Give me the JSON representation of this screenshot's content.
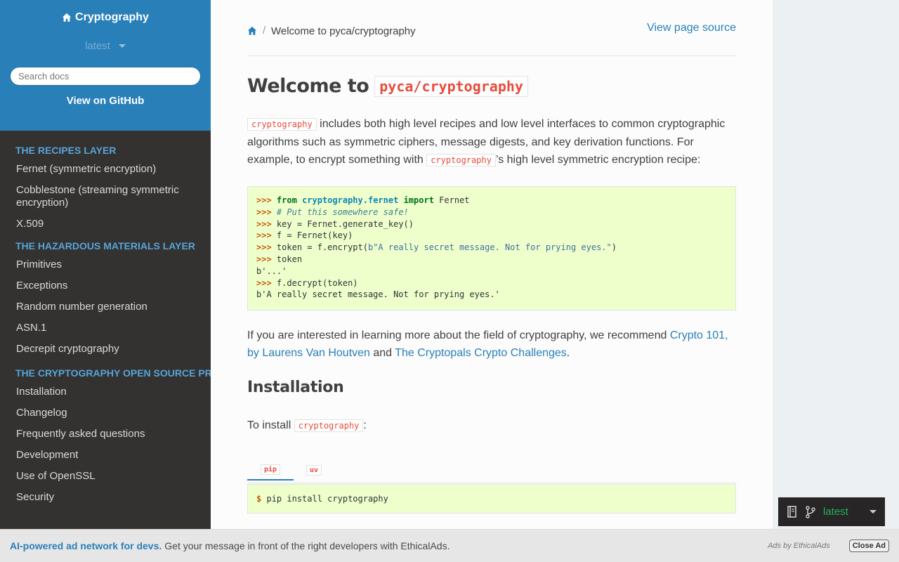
{
  "sidebar": {
    "project_name": "Cryptography",
    "version": "latest",
    "search_placeholder": "Search docs",
    "github_link": "View on GitHub",
    "sections": [
      {
        "caption": "The Recipes Layer",
        "items": [
          "Fernet (symmetric encryption)",
          "Cobblestone (streaming symmetric encryption)",
          "X.509"
        ]
      },
      {
        "caption": "The Hazardous Materials Layer",
        "items": [
          "Primitives",
          "Exceptions",
          "Random number generation",
          "ASN.1",
          "Decrepit cryptography"
        ]
      },
      {
        "caption": "The Cryptography Open Source Project",
        "items": [
          "Installation",
          "Changelog",
          "Frequently asked questions",
          "Development",
          "Use of OpenSSL",
          "Security"
        ]
      }
    ]
  },
  "breadcrumbs": {
    "separator": "/",
    "page": "Welcome to pyca/cryptography",
    "view_source": "View page source"
  },
  "main": {
    "title_text": "Welcome to",
    "title_code": "pyca/cryptography",
    "intro": {
      "code1": "cryptography",
      "text1": " includes both high level recipes and low level interfaces to common cryptographic algorithms such as symmetric ciphers, message digests, and key derivation functions. For example, to encrypt something with ",
      "code2": "cryptography",
      "text2": "’s high level symmetric encryption recipe:"
    },
    "code_example": {
      "prompt": ">>>",
      "line1_kw1": "from",
      "line1_mod": "cryptography.fernet",
      "line1_kw2": "import",
      "line1_name": "Fernet",
      "line2_comment": "# Put this somewhere safe!",
      "line3": "key = Fernet.generate_key()",
      "line4": "f = Fernet(key)",
      "line5_pre": "token = f.encrypt(",
      "line5_str": "b\"A really secret message. Not for prying eyes.\"",
      "line5_post": ")",
      "line6": "token",
      "line7": "b'...'",
      "line8": "f.decrypt(token)",
      "line9": "b'A really secret message. Not for prying eyes.'"
    },
    "learn_more": {
      "text1": "If you are interested in learning more about the field of cryptography, we recommend ",
      "link1": "Crypto 101, by Laurens Van Houtven",
      "text2": " and ",
      "link2": "The Cryptopals Crypto Challenges",
      "text3": "."
    },
    "installation": {
      "heading": "Installation",
      "text": "To install ",
      "code": "cryptography",
      "text_end": ":",
      "tabs": [
        "pip",
        "uv"
      ],
      "active_tab": "pip",
      "prompt": "$",
      "command": "pip install cryptography"
    }
  },
  "flyout": {
    "version": "latest"
  },
  "ad": {
    "strong": "AI-powered ad network for devs.",
    "text": "Get your message in front of the right developers with EthicalAds.",
    "ads_by": "Ads by EthicalAds",
    "close": "Close Ad"
  },
  "colors": {
    "sidebar_top": "#2980b9",
    "sidebar_bg": "#343131",
    "caption": "#55a5d9",
    "link": "#2980b9",
    "code_red": "#e74c3c",
    "code_bg": "#eeffcc",
    "version_green": "#27ae60"
  },
  "icons": [
    "home-icon",
    "caret-down-icon",
    "book-icon",
    "git-branch-icon"
  ]
}
